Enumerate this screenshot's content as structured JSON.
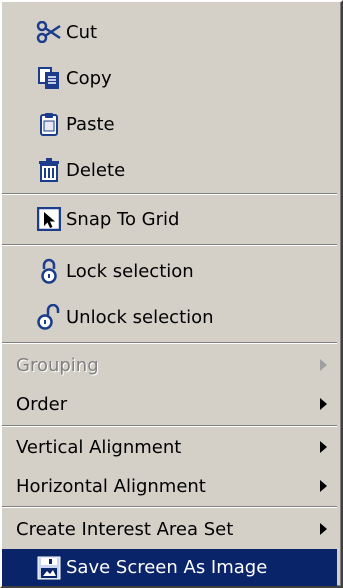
{
  "context_menu": {
    "items": [
      {
        "label": "Cut",
        "icon": "scissors-icon"
      },
      {
        "label": "Copy",
        "icon": "copy-icon"
      },
      {
        "label": "Paste",
        "icon": "paste-icon"
      },
      {
        "label": "Delete",
        "icon": "trash-icon"
      },
      {
        "label": "Snap To Grid",
        "icon": "snap-grid-icon"
      },
      {
        "label": "Lock selection",
        "icon": "lock-icon"
      },
      {
        "label": "Unlock selection",
        "icon": "unlock-icon"
      },
      {
        "label": "Grouping",
        "submenu": true,
        "enabled": false
      },
      {
        "label": "Order",
        "submenu": true
      },
      {
        "label": "Vertical Alignment",
        "submenu": true
      },
      {
        "label": "Horizontal Alignment",
        "submenu": true
      },
      {
        "label": "Create Interest Area Set",
        "submenu": true
      },
      {
        "label": "Save Screen As Image",
        "icon": "save-image-icon",
        "selected": true
      }
    ]
  },
  "colors": {
    "menu_background": "#d4d0c8",
    "highlight_background": "#0a246a",
    "highlight_text": "#ffffff",
    "disabled_text": "#808080",
    "icon_blue": "#1c3c8c"
  }
}
